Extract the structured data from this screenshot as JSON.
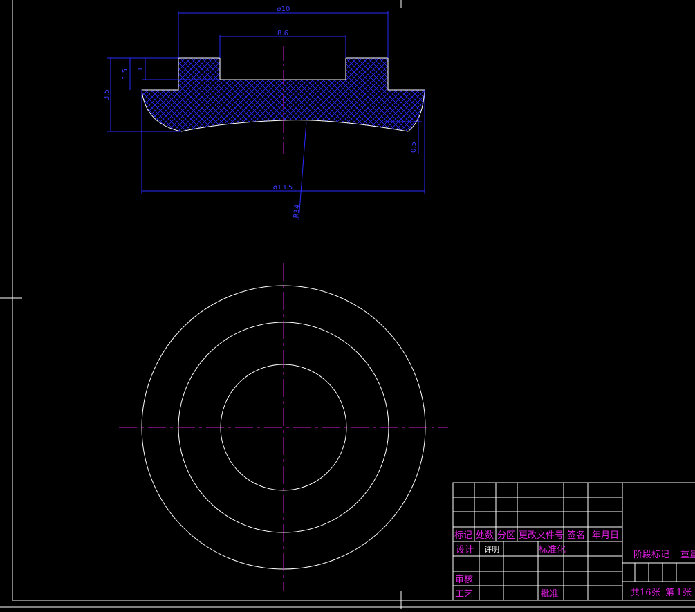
{
  "colors": {
    "background": "#000000",
    "outline": "#ffffff",
    "dimension": "#2a2aff",
    "hatch": "#2a2aff",
    "centerline": "#d81ed8",
    "titleblock_text": "#e020e0",
    "titleblock_lines": "#ffffff"
  },
  "dimensions": {
    "outer_top_dia": "ø10",
    "bore_dia": "8.6",
    "height_total": "3.5",
    "height_step": "1.5",
    "height_small": "1",
    "base_dia": "ø13.5",
    "depth": "0.5",
    "radius": "R34"
  },
  "title_block": {
    "col_mark": "标记",
    "col_count": "处数",
    "col_zone": "分区",
    "col_change_doc": "更改文件号",
    "col_sign": "签名",
    "col_date": "年月日",
    "row_design": "设计",
    "designer_name": "许明",
    "standardize": "标准化",
    "stage_mark": "阶段标记",
    "weight": "重量",
    "review": "审核",
    "process": "工艺",
    "approve": "批准",
    "sheet_total_prefix": "共",
    "sheet_total": "16",
    "sheet_unit": "张",
    "sheet_no_prefix": "第",
    "sheet_no": "1",
    "sheet_no_unit": "张"
  }
}
